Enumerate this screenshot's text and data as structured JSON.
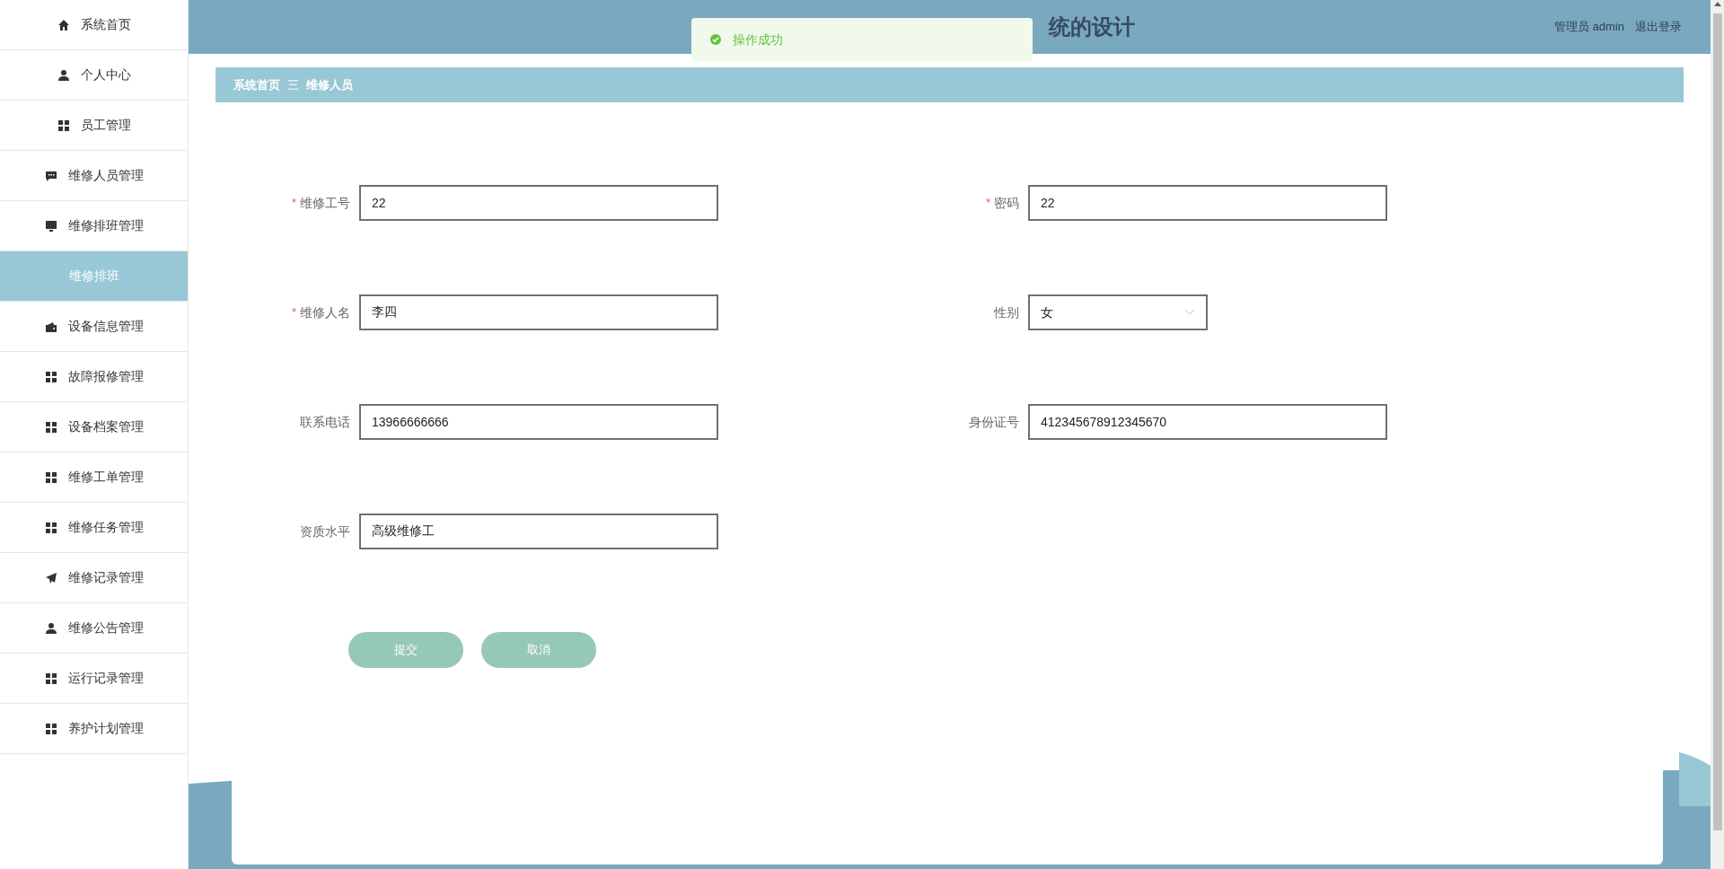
{
  "sidebar": {
    "items": [
      {
        "label": "系统首页",
        "kind": "home",
        "selected": false
      },
      {
        "label": "个人中心",
        "kind": "user",
        "selected": false
      },
      {
        "label": "员工管理",
        "kind": "grid",
        "selected": false
      },
      {
        "label": "维修人员管理",
        "kind": "chat",
        "selected": false
      },
      {
        "label": "维修排班管理",
        "kind": "monitor",
        "selected": false
      },
      {
        "label": "维修排班",
        "kind": "subitem",
        "selected": true
      },
      {
        "label": "设备信息管理",
        "kind": "wallet",
        "selected": false
      },
      {
        "label": "故障报修管理",
        "kind": "grid",
        "selected": false
      },
      {
        "label": "设备档案管理",
        "kind": "grid",
        "selected": false
      },
      {
        "label": "维修工单管理",
        "kind": "grid",
        "selected": false
      },
      {
        "label": "维修任务管理",
        "kind": "grid",
        "selected": false
      },
      {
        "label": "维修记录管理",
        "kind": "send",
        "selected": false
      },
      {
        "label": "维修公告管理",
        "kind": "user",
        "selected": false
      },
      {
        "label": "运行记录管理",
        "kind": "grid",
        "selected": false
      },
      {
        "label": "养护计划管理",
        "kind": "grid",
        "selected": false
      }
    ]
  },
  "header": {
    "title": "统的设计",
    "user": "管理员 admin",
    "logout": "退出登录"
  },
  "toast": {
    "message": "操作成功"
  },
  "breadcrumb": {
    "items": [
      "系统首页",
      "维修人员"
    ],
    "separator": "三"
  },
  "form": {
    "fields": [
      {
        "label": "维修工号",
        "value": "22",
        "marker": "*",
        "kind": "text"
      },
      {
        "label": "密码",
        "value": "22",
        "marker": "*",
        "kind": "text"
      },
      {
        "label": "维修人名",
        "value": "李四",
        "marker": "*",
        "kind": "text"
      },
      {
        "label": "性别",
        "value": "女",
        "kind": "select"
      },
      {
        "label": "联系电话",
        "value": "13966666666",
        "kind": "text"
      },
      {
        "label": "身份证号",
        "value": "412345678912345670",
        "kind": "text"
      },
      {
        "label": "资质水平",
        "value": "高级维修工",
        "kind": "text"
      }
    ],
    "buttons": [
      "提交",
      "取消"
    ]
  }
}
